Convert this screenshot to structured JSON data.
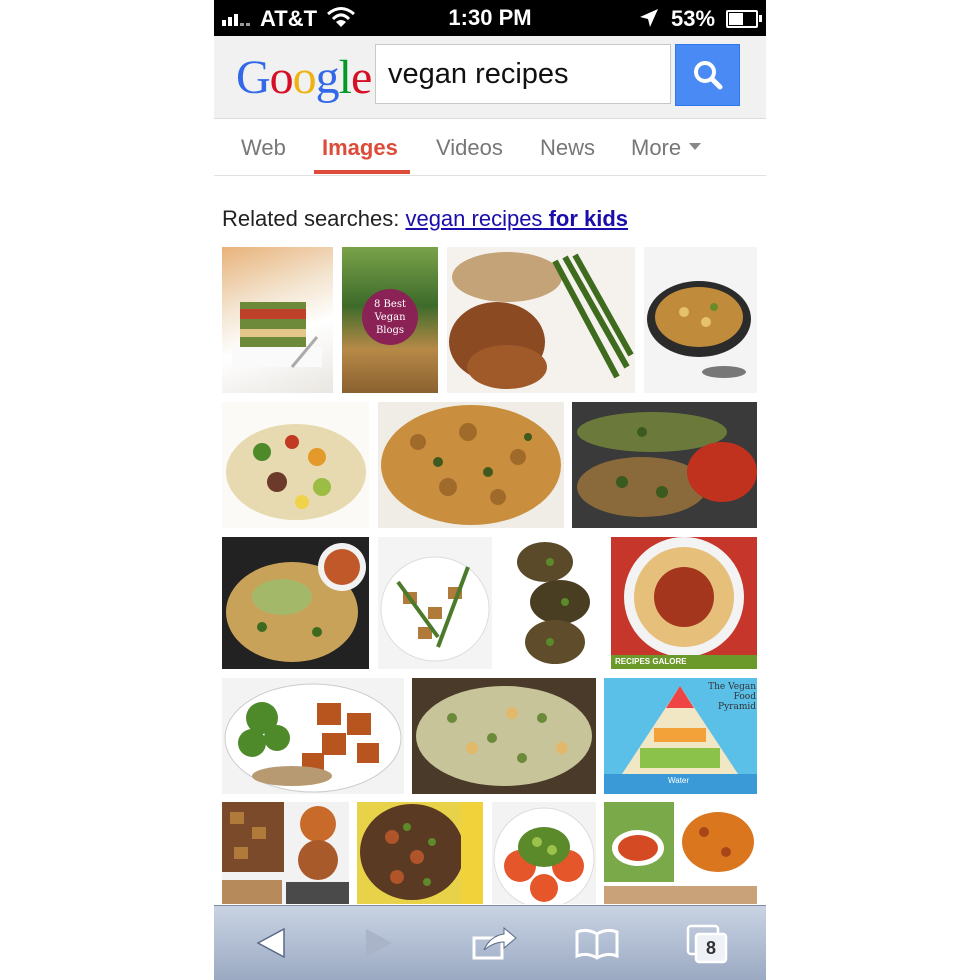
{
  "status_bar": {
    "carrier": "AT&T",
    "time": "1:30 PM",
    "battery_percent": "53%"
  },
  "search": {
    "logo": "Google",
    "query": "vegan recipes"
  },
  "tabs": {
    "web": "Web",
    "images": "Images",
    "videos": "Videos",
    "news": "News",
    "more": "More"
  },
  "related": {
    "prefix": "Related searches:",
    "link_plain": "vegan recipes",
    "link_bold": "for kids"
  },
  "image_text": {
    "blog_badge": "8 Best Vegan Blogs",
    "recipes_galore": "RECIPES GALORE",
    "pyramid_title": "The Vegan Food Pyramid",
    "pyramid_water": "Water"
  },
  "toolbar": {
    "tabs_count": "8"
  },
  "colors": {
    "accent": "#dd4b39",
    "link": "#1a0dab",
    "search_button": "#4a8af4"
  }
}
